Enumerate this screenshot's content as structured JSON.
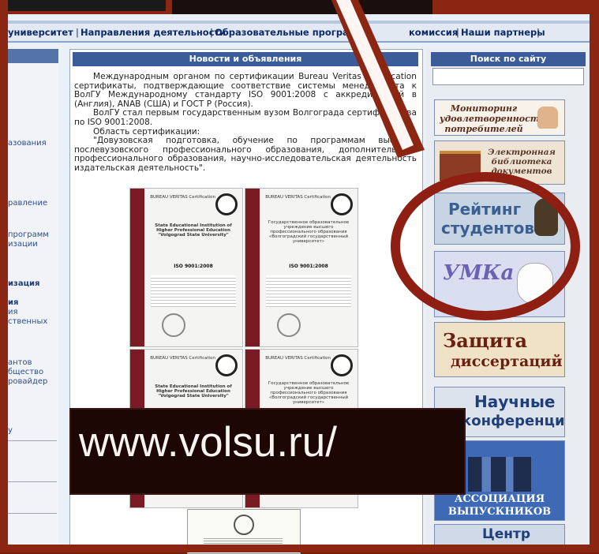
{
  "nav": {
    "items": [
      "университет",
      "Направления деятельности",
      "Образовательные программ",
      "комиссия",
      "Наши партнеры"
    ],
    "separator": "|"
  },
  "left_sidebar": {
    "items": [
      "азования",
      "равление",
      "программ",
      "изации",
      "изация",
      "ия",
      "ия",
      "ственных",
      "антов",
      "бщество",
      "ровайдер",
      "у"
    ]
  },
  "news": {
    "heading": "Новости и объявления",
    "paragraph1": "Международным органом по сертификации Bureau Veritas Certification сертификаты, подтверждающие соответствие системы менеджмента к ВолГУ Международному стандарту ISO 9001:2008 с аккредитацией в (Англия), ANAB (США) и ГОСТ Р (Россия).",
    "paragraph2": "ВолГУ стал первым государственным вузом Волгограда сертифицирова по ISO 9001:2008.",
    "paragraph3": "Область сертификации:",
    "paragraph4": "\"Довузовская подготовка, обучение по программам высшего послевузовского профессионального образования, дополнительного профессионального образования, научно-исследовательская деятельность издательская деятельность\".",
    "cert_brand": "BUREAU VERITAS Certification",
    "cert_title_en": "State Educational Institution of Higher Professional Education \"Volgograd State University\"",
    "cert_title_ru": "Государственное образовательное учреждение высшего профессионального образования «Волгоградский государственный университет»",
    "cert_standard": "ISO 9001:2008"
  },
  "search": {
    "heading": "Поиск по сайту",
    "placeholder": ""
  },
  "banners": {
    "monitoring": "Мониторинг удовлетворенности потребителей",
    "library": "Электронная библиотека документов",
    "rating": "Рейтинг студентов",
    "umka": "УМКа",
    "defense_line1": "Защита",
    "defense_line2": "диссертаций",
    "conf_line1": "Научные",
    "conf_line2": "конференции",
    "alumni_line1": "АССОЦИАЦИЯ",
    "alumni_line2": "ВЫПУСКНИКОВ",
    "center": "Центр"
  },
  "overlay": {
    "url": "www.volsu.ru/"
  },
  "colors": {
    "frame": "#8b2613",
    "header_blue": "#3a5d9a",
    "nav_text": "#0d2a66",
    "highlight_ring": "#8f1f12"
  }
}
